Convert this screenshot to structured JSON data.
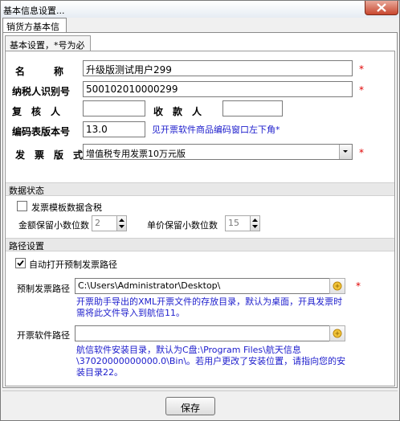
{
  "window": {
    "title": "基本信息设置..."
  },
  "tabs": {
    "outer": "销货方基本信息",
    "inner": "基本设置，*号为必填"
  },
  "fields": {
    "name_label": "名　　　称",
    "name_value": "升级版测试用户299",
    "taxid_label": "纳税人识别号",
    "taxid_value": "500102010000299",
    "reviewer_label": "复　核　人",
    "reviewer_value": "",
    "payee_label": "收　款　人",
    "payee_value": "",
    "code_version_label": "编码表版本号",
    "code_version_value": "13.0",
    "code_version_hint": "见开票软件商品编码窗口左下角*",
    "invoice_version_label": "发　票　版　式",
    "invoice_version_value": "增值税专用发票10万元版",
    "required_mark": "*"
  },
  "data_state": {
    "header": "数据状态",
    "template_tax_label": "发票模板数据含税",
    "template_tax_checked": false,
    "amount_decimals_label": "金额保留小数位数",
    "amount_decimals_value": "2",
    "price_decimals_label": "单价保留小数位数",
    "price_decimals_value": "15"
  },
  "path_settings": {
    "header": "路径设置",
    "auto_open_label": "自动打开预制发票路径",
    "auto_open_checked": true,
    "preset_path_label": "预制发票路径",
    "preset_path_value": "C:\\Users\\Administrator\\Desktop\\",
    "preset_path_note": "开票助手导出的XML开票文件的存放目录，默认为桌面，开具发票时需将此文件导入到航信11。",
    "software_path_label": "开票软件路径",
    "software_path_value": "",
    "software_path_note": "航信软件安装目录，默认为C盘:\\Program Files\\航天信息\\37020000000000.0\\Bin\\。若用户更改了安装位置，请指向您的安装目录22。"
  },
  "actions": {
    "save": "保存"
  },
  "colors": {
    "note_blue": "#1c1ccc",
    "required_red": "#e00000"
  }
}
